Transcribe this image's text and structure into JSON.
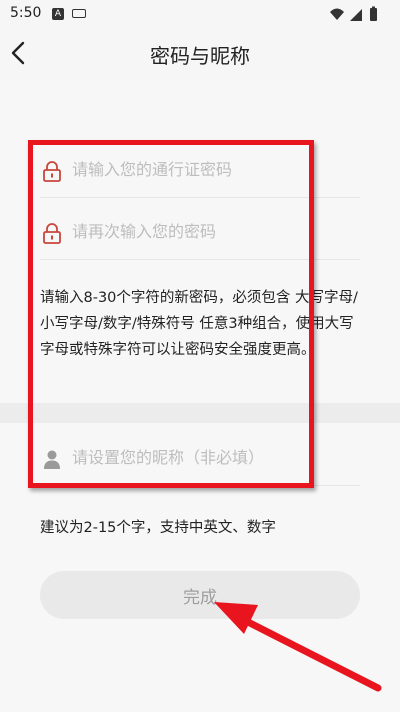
{
  "status_bar": {
    "time": "5:50",
    "notification_a": "A"
  },
  "header": {
    "title": "密码与昵称"
  },
  "form": {
    "password_placeholder": "请输入您的通行证密码",
    "confirm_placeholder": "请再次输入您的密码",
    "password_hint": "请输入8-30个字符的新密码，必须包含 大写字母/小写字母/数字/特殊符号 任意3种组合，使用大写字母或特殊字符可以让密码安全强度更高。",
    "nickname_placeholder": "请设置您的昵称（非必填）",
    "nickname_hint": "建议为2-15个字，支持中英文、数字",
    "done_label": "完成"
  },
  "colors": {
    "lock_icon": "#c8463c",
    "annotation_red": "#e8141e",
    "button_bg": "#e9e9e9",
    "button_text": "#9e9e9e"
  },
  "icons": [
    "back-arrow-icon",
    "lock-icon",
    "user-icon",
    "wifi-icon",
    "signal-icon",
    "battery-icon"
  ]
}
